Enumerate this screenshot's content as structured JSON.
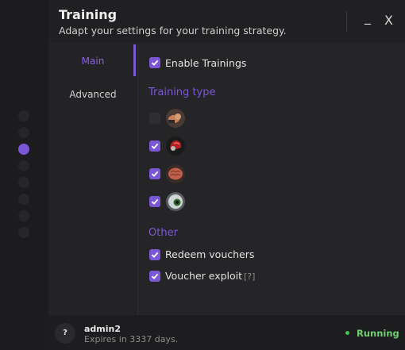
{
  "window": {
    "title": "Training",
    "subtitle": "Adapt your settings for your training strategy.",
    "minimize_label": "_",
    "close_label": "X"
  },
  "sidebar": {
    "active_dot_index": 2,
    "dot_count": 8
  },
  "nav": {
    "items": [
      {
        "label": "Main",
        "active": true
      },
      {
        "label": "Advanced",
        "active": false
      }
    ]
  },
  "main": {
    "enable_trainings": {
      "label": "Enable Trainings",
      "checked": true
    },
    "training_type_heading": "Training type",
    "training_types": [
      {
        "icon": "strength-arm-icon",
        "checked": false
      },
      {
        "icon": "helmet-icon",
        "checked": true
      },
      {
        "icon": "brain-icon",
        "checked": true
      },
      {
        "icon": "eye-icon",
        "checked": true
      }
    ],
    "other_heading": "Other",
    "redeem_vouchers": {
      "label": "Redeem vouchers",
      "checked": true
    },
    "voucher_exploit": {
      "label": "Voucher exploit",
      "checked": true,
      "help": "[?]"
    }
  },
  "footer": {
    "help_label": "?",
    "username": "admin2",
    "expires": "Expires in 3337 days.",
    "status": "Running",
    "status_color": "#46c34a"
  },
  "colors": {
    "accent": "#7b57d6",
    "background": "#252527"
  }
}
